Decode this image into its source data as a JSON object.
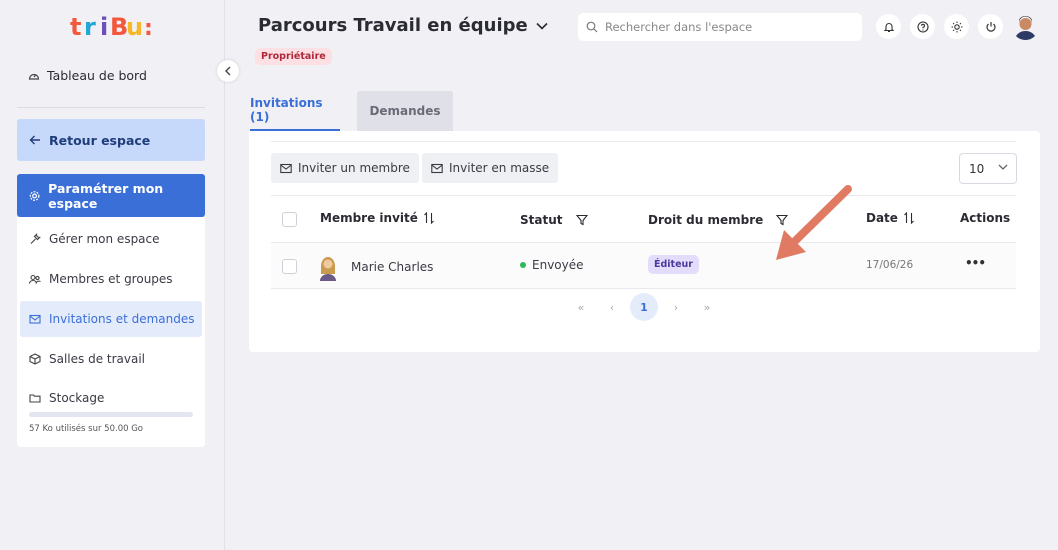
{
  "brand": {
    "logo_text": "tribu:",
    "accent": "#3a6fd8"
  },
  "sidebar": {
    "dashboard": "Tableau de bord",
    "back": "Retour espace",
    "settings": "Paramétrer mon espace",
    "items": [
      {
        "label": "Gérer mon espace",
        "icon": "wrench-icon"
      },
      {
        "label": "Membres et groupes",
        "icon": "users-icon"
      },
      {
        "label": "Invitations et demandes",
        "icon": "mail-icon",
        "active": true
      },
      {
        "label": "Salles de travail",
        "icon": "cube-icon"
      },
      {
        "label": "Stockage",
        "icon": "folder-icon"
      }
    ],
    "storage_text": "57 Ko utilisés sur 50.00 Go",
    "storage_fraction": 0.0
  },
  "header": {
    "title": "Parcours Travail en équipe",
    "role": "Propriétaire",
    "search_placeholder": "Rechercher dans l'espace"
  },
  "tabs": [
    {
      "label": "Invitations (1)",
      "active": true
    },
    {
      "label": "Demandes",
      "active": false
    }
  ],
  "toolbar": {
    "invite_member": "Inviter un membre",
    "invite_bulk": "Inviter en masse",
    "per_page": "10"
  },
  "table": {
    "headers": {
      "member": "Membre invité",
      "status": "Statut",
      "role": "Droit du membre",
      "date": "Date",
      "actions": "Actions"
    },
    "rows": [
      {
        "name": "Marie Charles",
        "status": "Envoyée",
        "role": "Éditeur",
        "date": "17/06/26",
        "actions": "•••"
      }
    ]
  },
  "pagination": {
    "first": "«",
    "prev": "‹",
    "current": "1",
    "next": "›",
    "last": "»"
  }
}
